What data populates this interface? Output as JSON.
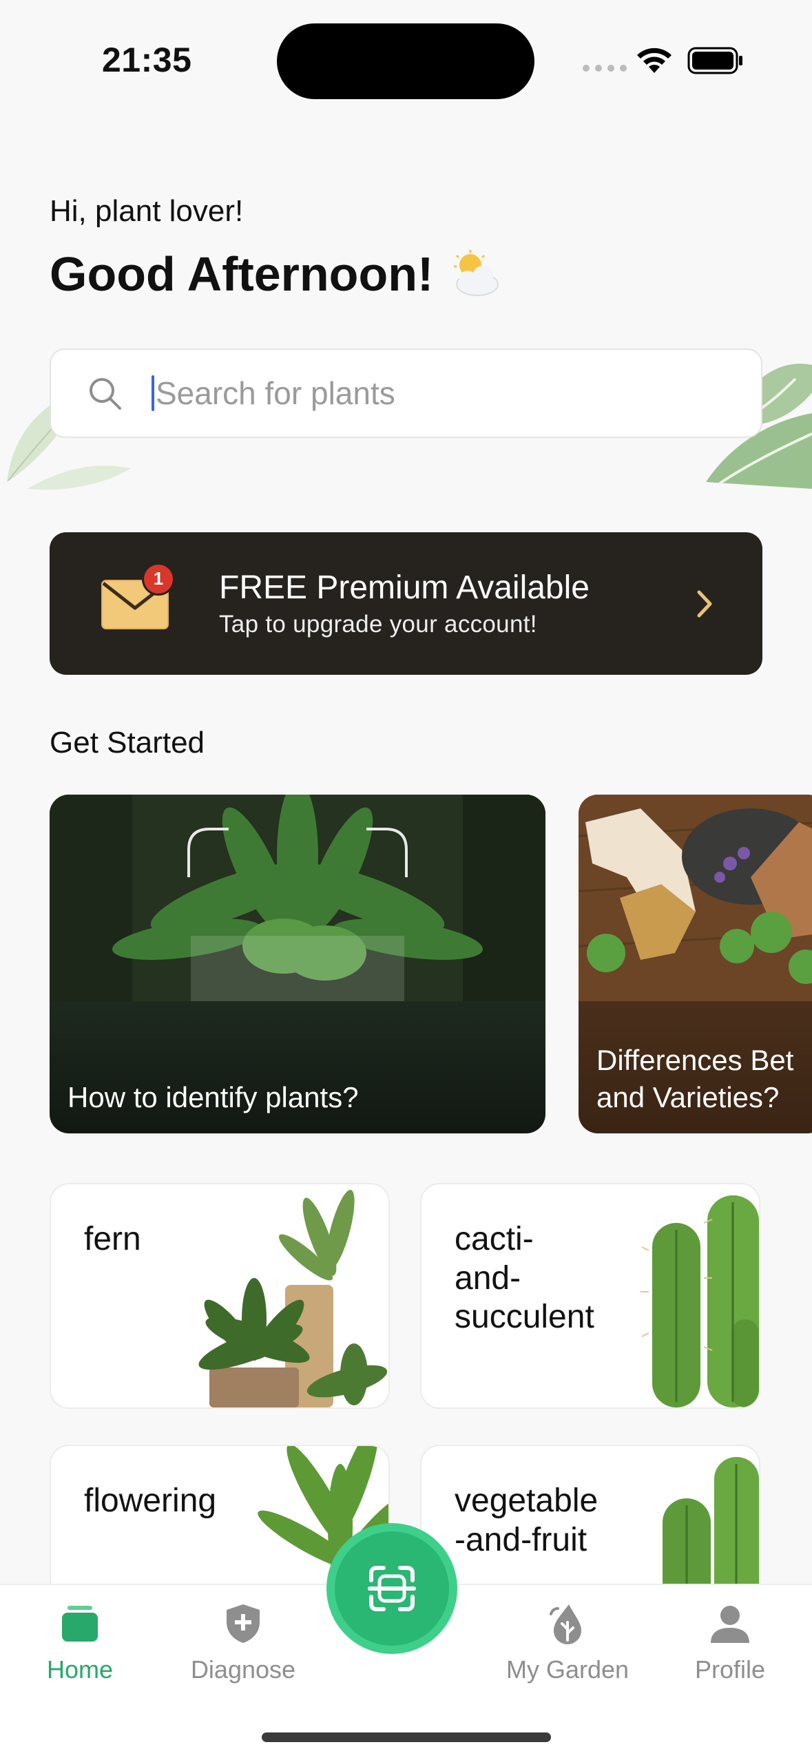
{
  "status_bar": {
    "time": "21:35"
  },
  "greeting": {
    "subtitle": "Hi, plant lover!",
    "title": "Good Afternoon!"
  },
  "search": {
    "placeholder": "Search for plants",
    "value": ""
  },
  "premium": {
    "badge_count": "1",
    "title": "FREE Premium Available",
    "subtitle": "Tap to upgrade your account!"
  },
  "get_started": {
    "title": "Get Started",
    "cards": [
      {
        "label": "How to identify plants?"
      },
      {
        "label_line1": "Differences Bet",
        "label_line2": "and Varieties?"
      }
    ]
  },
  "categories": [
    {
      "label": "fern"
    },
    {
      "label_line1": "cacti-",
      "label_line2": "and-",
      "label_line3": "succulent"
    },
    {
      "label": "flowering"
    },
    {
      "label_line1": "vegetable",
      "label_line2": "-and-fruit"
    }
  ],
  "tabbar": {
    "items": [
      {
        "label": "Home",
        "icon": "home-icon",
        "active": true
      },
      {
        "label": "Diagnose",
        "icon": "shield-plus-icon"
      },
      {
        "label": "My Garden",
        "icon": "leaf-drop-icon"
      },
      {
        "label": "Profile",
        "icon": "person-icon"
      }
    ],
    "scan_icon": "scan-icon"
  },
  "colors": {
    "accent": "#28a86a",
    "banner_bg": "#26231e",
    "badge": "#d9372a"
  }
}
